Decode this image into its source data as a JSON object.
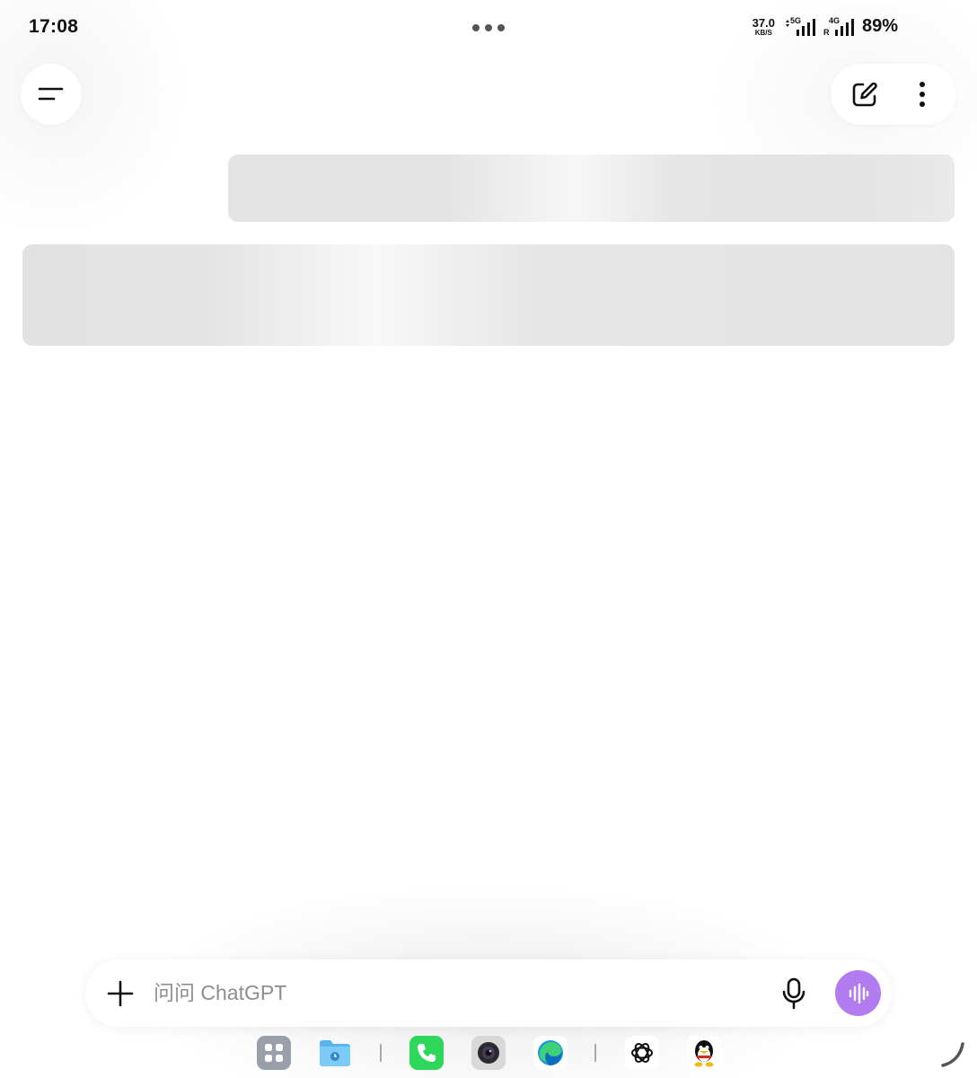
{
  "status_bar": {
    "time": "17:08",
    "net_speed_value": "37.0",
    "net_speed_unit": "KB/S",
    "sim1_tag": "5G",
    "sim2_tag": "4G",
    "roaming_tag": "R",
    "battery": "89%"
  },
  "header": {
    "menu_icon": "menu-icon",
    "new_chat_icon": "edit-icon",
    "more_icon": "more-vertical-icon"
  },
  "composer": {
    "placeholder": "问问 ChatGPT",
    "value": "",
    "plus_icon": "plus-icon",
    "mic_icon": "mic-icon",
    "voice_icon": "voice-wave-icon",
    "voice_color": "#b27cf0"
  },
  "dock": {
    "apps": [
      "app-grid",
      "files",
      "phone",
      "camera",
      "edge",
      "chatgpt",
      "qq"
    ]
  }
}
